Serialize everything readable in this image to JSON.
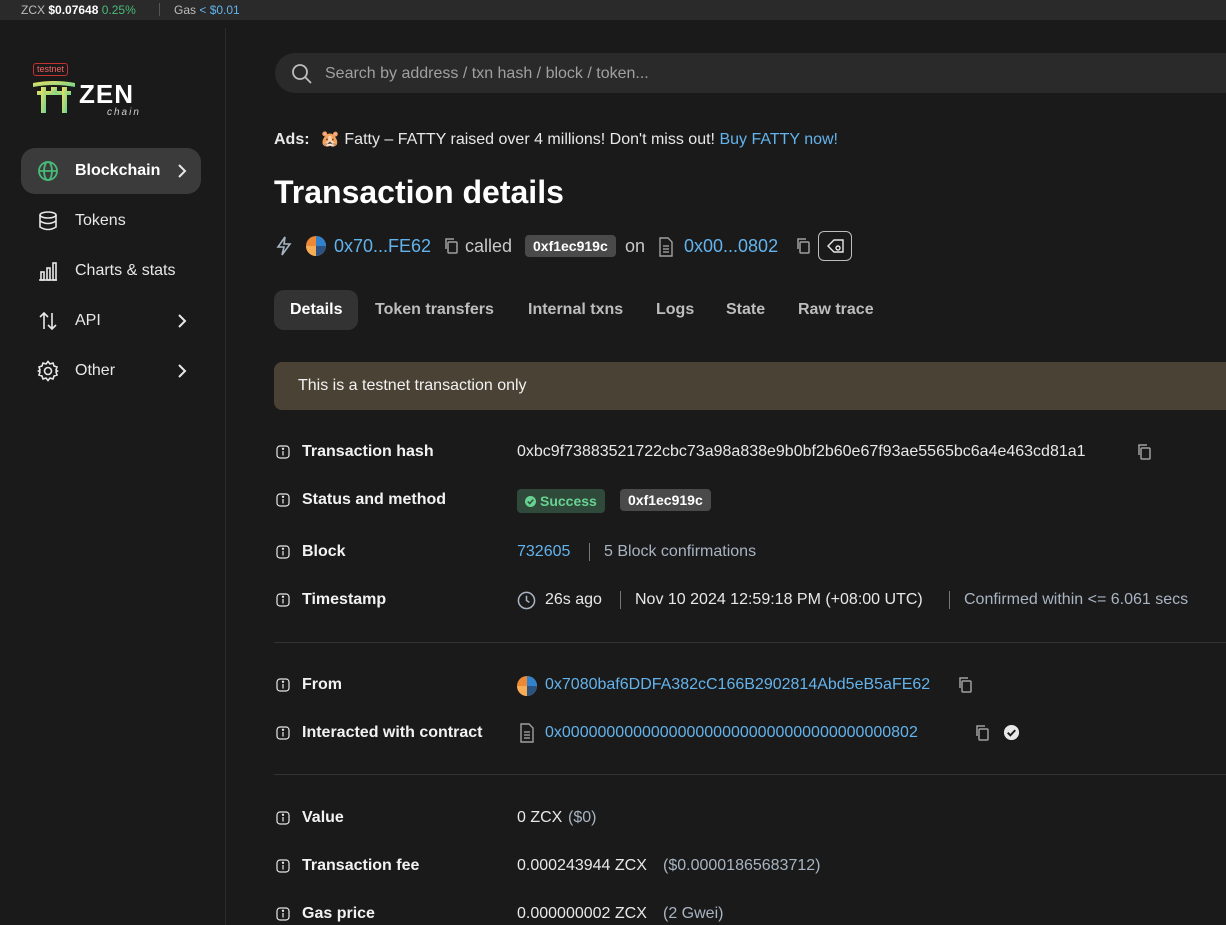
{
  "topbar": {
    "token_symbol": "ZCX",
    "token_price": "$0.07648",
    "token_change": "0.25%",
    "gas_label": "Gas",
    "gas_value": "< $0.01"
  },
  "logo": {
    "badge": "testnet",
    "brand": "ZEN",
    "sub": "chain"
  },
  "sidebar": {
    "items": [
      {
        "label": "Blockchain",
        "icon": "globe-icon",
        "active": true,
        "has_chevron": true
      },
      {
        "label": "Tokens",
        "icon": "coins-icon",
        "active": false,
        "has_chevron": false
      },
      {
        "label": "Charts & stats",
        "icon": "chart-icon",
        "active": false,
        "has_chevron": false
      },
      {
        "label": "API",
        "icon": "api-arrows-icon",
        "active": false,
        "has_chevron": true
      },
      {
        "label": "Other",
        "icon": "gear-icon",
        "active": false,
        "has_chevron": true
      }
    ]
  },
  "search": {
    "placeholder": "Search by address / txn hash / block / token..."
  },
  "ads": {
    "prefix": "Ads:",
    "emoji": "🐹",
    "text": "Fatty – FATTY raised over 4 millions! Don't miss out!",
    "cta": "Buy FATTY now!"
  },
  "page_title": "Transaction details",
  "summary": {
    "from_short": "0x70...FE62",
    "called": "called",
    "method": "0xf1ec919c",
    "on": "on",
    "to_short": "0x00...0802"
  },
  "tabs": [
    "Details",
    "Token transfers",
    "Internal txns",
    "Logs",
    "State",
    "Raw trace"
  ],
  "banner": "This is a testnet transaction only",
  "details": {
    "tx_hash_label": "Transaction hash",
    "tx_hash": "0xbc9f73883521722cbc73a98a838e9b0bf2b60e67f93ae5565bc6a4e463cd81a1",
    "status_label": "Status and method",
    "status": "Success",
    "method": "0xf1ec919c",
    "block_label": "Block",
    "block": "732605",
    "confirmations": "5 Block confirmations",
    "timestamp_label": "Timestamp",
    "time_ago": "26s ago",
    "timestamp": "Nov 10 2024 12:59:18 PM (+08:00 UTC)",
    "confirmed_within": "Confirmed within <= 6.061 secs",
    "from_label": "From",
    "from": "0x7080baf6DDFA382cC166B2902814Abd5eB5aFE62",
    "contract_label": "Interacted with contract",
    "contract": "0x0000000000000000000000000000000000000802",
    "value_label": "Value",
    "value": "0 ZCX",
    "value_usd": "($0)",
    "fee_label": "Transaction fee",
    "fee": "0.000243944 ZCX",
    "fee_usd": "($0.00001865683712)",
    "gas_price_label": "Gas price",
    "gas_price": "0.000000002 ZCX",
    "gas_price_gwei": "(2 Gwei)"
  },
  "colors": {
    "link": "#63b3ed",
    "success": "#68d391",
    "banner_bg": "#4a4234",
    "active_nav_bg": "#3b3b3b"
  }
}
